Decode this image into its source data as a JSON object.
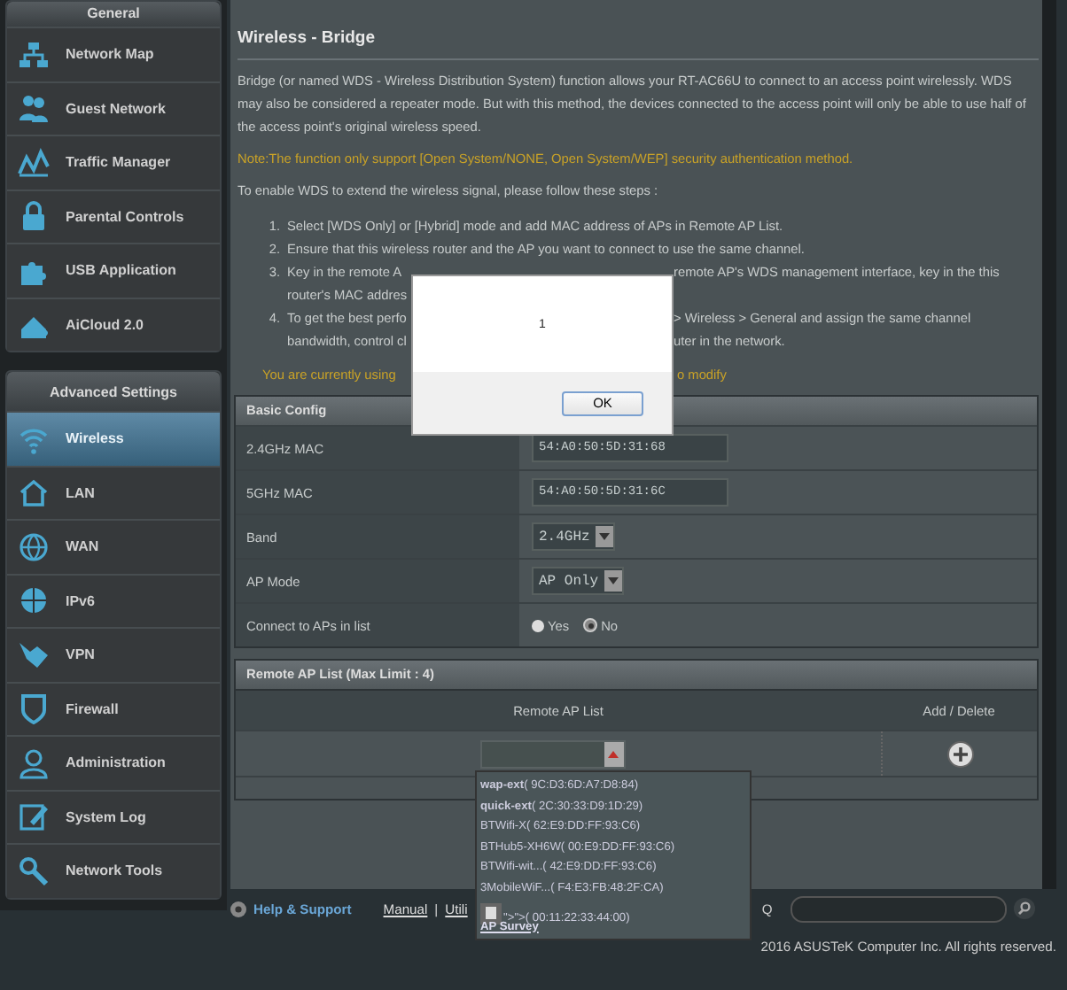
{
  "sidebar": {
    "sections": [
      {
        "title": "General",
        "items": [
          {
            "label": "Network Map",
            "selected": false
          },
          {
            "label": "Guest Network",
            "selected": false
          },
          {
            "label": "Traffic Manager",
            "selected": false
          },
          {
            "label": "Parental Controls",
            "selected": false
          },
          {
            "label": "USB Application",
            "selected": false
          },
          {
            "label": "AiCloud 2.0",
            "selected": false
          }
        ]
      },
      {
        "title": "Advanced Settings",
        "items": [
          {
            "label": "Wireless",
            "selected": true
          },
          {
            "label": "LAN",
            "selected": false
          },
          {
            "label": "WAN",
            "selected": false
          },
          {
            "label": "IPv6",
            "selected": false
          },
          {
            "label": "VPN",
            "selected": false
          },
          {
            "label": "Firewall",
            "selected": false
          },
          {
            "label": "Administration",
            "selected": false
          },
          {
            "label": "System Log",
            "selected": false
          },
          {
            "label": "Network Tools",
            "selected": false
          }
        ]
      }
    ]
  },
  "main": {
    "title": "Wireless - Bridge",
    "intro": "Bridge (or named WDS - Wireless Distribution System) function allows your RT-AC66U to connect to an access point wirelessly. WDS may also be considered a repeater mode. But with this method, the devices connected to the access point will only be able to use half of the access point's original wireless speed.",
    "note": "Note:The function only support [Open System/NONE, Open System/WEP] security authentication method.",
    "steps_intro": "To enable WDS to extend the wireless signal, please follow these steps :",
    "steps": [
      {
        "number": "1.",
        "lines": [
          {
            "left": "Select [WDS Only] or [Hybrid] mode and add MAC address of APs in Remote AP List."
          }
        ]
      },
      {
        "number": "2.",
        "lines": [
          {
            "left": "Ensure that this wireless router and the AP you want to connect to use the same channel."
          }
        ]
      },
      {
        "number": "3.",
        "lines": [
          {
            "left": "Key in the remote A",
            "right": "remote AP's WDS management interface, key in the this"
          },
          {
            "left": "router's MAC addres"
          }
        ]
      },
      {
        "number": "4.",
        "lines": [
          {
            "left": "To get the best perfo",
            "right": "> Wireless > General and assign the same channel"
          },
          {
            "left": "bandwidth, control cl",
            "right": "uter in the network."
          }
        ]
      }
    ],
    "mode_notice": {
      "left": "You are currently using",
      "right": "o modify"
    },
    "basic_config": {
      "title": "Basic Config",
      "rows": [
        {
          "kind": "text",
          "label": "2.4GHz MAC",
          "value": "54:A0:50:5D:31:68"
        },
        {
          "kind": "text",
          "label": "5GHz MAC",
          "value": "54:A0:50:5D:31:6C"
        },
        {
          "kind": "select",
          "label": "Band",
          "value": "2.4GHz"
        },
        {
          "kind": "select",
          "label": "AP Mode",
          "value": "AP Only"
        },
        {
          "kind": "radio",
          "label": "Connect to APs in list",
          "options": [
            {
              "label": "Yes",
              "selected": false
            },
            {
              "label": "No",
              "selected": true
            }
          ]
        }
      ]
    },
    "remote_ap_list": {
      "title": "Remote AP List (Max Limit : 4)",
      "columns": [
        "Remote AP List",
        "Add / Delete"
      ]
    }
  },
  "dialog": {
    "message": "1",
    "button": "OK"
  },
  "ap_dropdown": {
    "items": [
      "**wap-ext**( 9C:D3:6D:A7:D8:84)",
      "**quick-ext**( 2C:30:33:D9:1D:29)",
      "BTWifi-X( 62:E9:DD:FF:93:C6)",
      "BTHub5-XH6W( 00:E9:DD:FF:93:C6)",
      "BTWifi-wit...( 42:E9:DD:FF:93:C6)",
      "3MobileWiF...( F4:E3:FB:48:2F:CA)",
      "\">\">( 00:11:22:33:44:00)"
    ],
    "link": "AP Survey"
  },
  "footer": {
    "help": "Help & Support",
    "links": [
      "Manual",
      "|",
      "Utili"
    ],
    "faq": "Q"
  },
  "copyright": "2016 ASUSTeK Computer Inc. All rights reserved."
}
